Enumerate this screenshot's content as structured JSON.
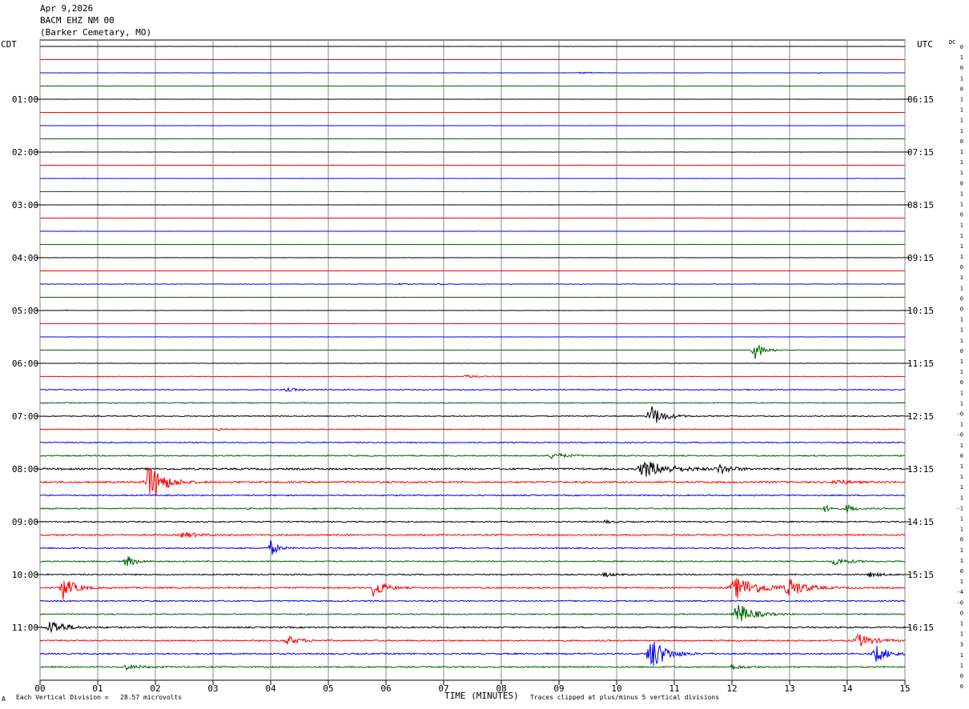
{
  "header": {
    "date": "Apr 9,2026",
    "station": "BACM EHZ NM 00",
    "location": "(Barker Cemetary, MO)"
  },
  "left_zone": "CDT",
  "right_zone": "UTC",
  "dc_label": "DC",
  "footer": {
    "scale": "Each Vertical Division =   28.57 microvolts",
    "xlabel": "TIME (MINUTES)",
    "clip": "Traces clipped at plus/minus 5 vertical divisions",
    "corner": "A"
  },
  "chart_data": {
    "type": "line",
    "title": "Apr 9,2026 BACM EHZ NM 00 (Barker Cemetary, MO)",
    "xlabel": "TIME (MINUTES)",
    "xlim": [
      0,
      15
    ],
    "x_ticks": [
      "00",
      "01",
      "02",
      "03",
      "04",
      "05",
      "06",
      "07",
      "08",
      "09",
      "10",
      "11",
      "12",
      "13",
      "14",
      "15"
    ],
    "grid": true,
    "trace_colors": [
      "#000000",
      "#ff0000",
      "#0000ff",
      "#006400"
    ],
    "left_time_labels": [
      "01:00",
      "02:00",
      "03:00",
      "04:00",
      "05:00",
      "06:00",
      "07:00",
      "08:00",
      "09:00",
      "10:00",
      "11:00"
    ],
    "right_time_labels": [
      "06:15",
      "07:15",
      "08:15",
      "09:15",
      "10:15",
      "11:15",
      "12:15",
      "13:15",
      "14:15",
      "15:15",
      "16:15"
    ],
    "dc_offsets": [
      "0",
      "1",
      "0",
      "1",
      "0",
      "1",
      "1",
      "1",
      "1",
      "0",
      "1",
      "1",
      "1",
      "0",
      "1",
      "1",
      "0",
      "1",
      "1",
      "1",
      "1",
      "0",
      "1",
      "1",
      "0",
      "0",
      "1",
      "1",
      "1",
      "0",
      "1",
      "1",
      "0",
      "1",
      "1",
      "-0",
      "1",
      "-0",
      "1",
      "0",
      "1",
      "1",
      "1",
      "1",
      "-1",
      "1",
      "1",
      "0",
      "1",
      "1",
      "0",
      "1",
      "-4",
      "-0",
      "0",
      "1",
      "1",
      "3",
      "1",
      "1",
      "0",
      "0"
    ],
    "trace_activity": [
      {
        "baseline": 0.01,
        "events": []
      },
      {
        "baseline": 0.01,
        "events": []
      },
      {
        "baseline": 0.02,
        "events": [
          {
            "t": 9.4,
            "amp": 0.12,
            "width": 0.6
          },
          {
            "t": 13.5,
            "amp": 0.08,
            "width": 0.2
          }
        ]
      },
      {
        "baseline": 0.01,
        "events": []
      },
      {
        "baseline": 0.01,
        "events": []
      },
      {
        "baseline": 0.01,
        "events": []
      },
      {
        "baseline": 0.01,
        "events": []
      },
      {
        "baseline": 0.01,
        "events": []
      },
      {
        "baseline": 0.01,
        "events": []
      },
      {
        "baseline": 0.01,
        "events": []
      },
      {
        "baseline": 0.01,
        "events": []
      },
      {
        "baseline": 0.01,
        "events": []
      },
      {
        "baseline": 0.01,
        "events": []
      },
      {
        "baseline": 0.01,
        "events": []
      },
      {
        "baseline": 0.01,
        "events": []
      },
      {
        "baseline": 0.01,
        "events": []
      },
      {
        "baseline": 0.015,
        "events": []
      },
      {
        "baseline": 0.01,
        "events": []
      },
      {
        "baseline": 0.04,
        "events": [
          {
            "t": 6.2,
            "amp": 0.15,
            "width": 0.4
          },
          {
            "t": 6.9,
            "amp": 0.15,
            "width": 0.4
          }
        ]
      },
      {
        "baseline": 0.015,
        "events": []
      },
      {
        "baseline": 0.015,
        "events": [
          {
            "t": 0.45,
            "amp": 0.15,
            "width": 0.1
          }
        ]
      },
      {
        "baseline": 0.015,
        "events": []
      },
      {
        "baseline": 0.02,
        "events": []
      },
      {
        "baseline": 0.03,
        "events": [
          {
            "t": 12.4,
            "amp": 1.6,
            "width": 0.35
          }
        ]
      },
      {
        "baseline": 0.03,
        "events": []
      },
      {
        "baseline": 0.06,
        "events": [
          {
            "t": 7.4,
            "amp": 0.25,
            "width": 0.4
          }
        ]
      },
      {
        "baseline": 0.08,
        "events": [
          {
            "t": 4.3,
            "amp": 0.25,
            "width": 0.5
          }
        ]
      },
      {
        "baseline": 0.08,
        "events": []
      },
      {
        "baseline": 0.08,
        "events": [
          {
            "t": 10.6,
            "amp": 1.9,
            "width": 0.45
          }
        ]
      },
      {
        "baseline": 0.08,
        "events": [
          {
            "t": 3.1,
            "amp": 0.25,
            "width": 0.2
          }
        ]
      },
      {
        "baseline": 0.09,
        "events": []
      },
      {
        "baseline": 0.1,
        "events": [
          {
            "t": 8.9,
            "amp": 0.5,
            "width": 0.5
          }
        ]
      },
      {
        "baseline": 0.15,
        "events": [
          {
            "t": 10.5,
            "amp": 1.4,
            "width": 0.9
          },
          {
            "t": 11.8,
            "amp": 0.8,
            "width": 0.4
          }
        ]
      },
      {
        "baseline": 0.15,
        "events": [
          {
            "t": 1.9,
            "amp": 3.5,
            "width": 0.5
          },
          {
            "t": 13.8,
            "amp": 0.5,
            "width": 0.4
          }
        ]
      },
      {
        "baseline": 0.1,
        "events": []
      },
      {
        "baseline": 0.1,
        "events": [
          {
            "t": 13.6,
            "amp": 0.6,
            "width": 0.3
          },
          {
            "t": 14.0,
            "amp": 0.6,
            "width": 0.3
          }
        ]
      },
      {
        "baseline": 0.1,
        "events": [
          {
            "t": 9.8,
            "amp": 0.25,
            "width": 0.3
          }
        ]
      },
      {
        "baseline": 0.12,
        "events": [
          {
            "t": 2.5,
            "amp": 0.5,
            "width": 0.5
          }
        ]
      },
      {
        "baseline": 0.1,
        "events": [
          {
            "t": 4.0,
            "amp": 1.4,
            "width": 0.25
          }
        ]
      },
      {
        "baseline": 0.1,
        "events": [
          {
            "t": 1.5,
            "amp": 1.1,
            "width": 0.3
          },
          {
            "t": 13.8,
            "amp": 0.6,
            "width": 0.5
          }
        ]
      },
      {
        "baseline": 0.1,
        "events": [
          {
            "t": 9.8,
            "amp": 0.4,
            "width": 0.3
          },
          {
            "t": 14.4,
            "amp": 0.4,
            "width": 0.4
          }
        ]
      },
      {
        "baseline": 0.12,
        "events": [
          {
            "t": 0.4,
            "amp": 2.0,
            "width": 0.4
          },
          {
            "t": 5.8,
            "amp": 1.8,
            "width": 0.35
          },
          {
            "t": 12.1,
            "amp": 1.8,
            "width": 0.9
          },
          {
            "t": 13.0,
            "amp": 1.6,
            "width": 0.5
          }
        ]
      },
      {
        "baseline": 0.1,
        "events": []
      },
      {
        "baseline": 0.1,
        "events": [
          {
            "t": 12.1,
            "amp": 2.0,
            "width": 0.5
          }
        ]
      },
      {
        "baseline": 0.12,
        "events": [
          {
            "t": 0.2,
            "amp": 1.3,
            "width": 0.5
          }
        ]
      },
      {
        "baseline": 0.12,
        "events": [
          {
            "t": 4.3,
            "amp": 0.8,
            "width": 0.4
          },
          {
            "t": 14.2,
            "amp": 1.1,
            "width": 0.5
          }
        ]
      },
      {
        "baseline": 0.12,
        "events": [
          {
            "t": 10.6,
            "amp": 3.0,
            "width": 0.5
          },
          {
            "t": 14.5,
            "amp": 1.5,
            "width": 0.4
          }
        ]
      },
      {
        "baseline": 0.12,
        "events": [
          {
            "t": 1.5,
            "amp": 0.4,
            "width": 0.5
          },
          {
            "t": 12.0,
            "amp": 0.4,
            "width": 0.4
          }
        ]
      }
    ]
  }
}
